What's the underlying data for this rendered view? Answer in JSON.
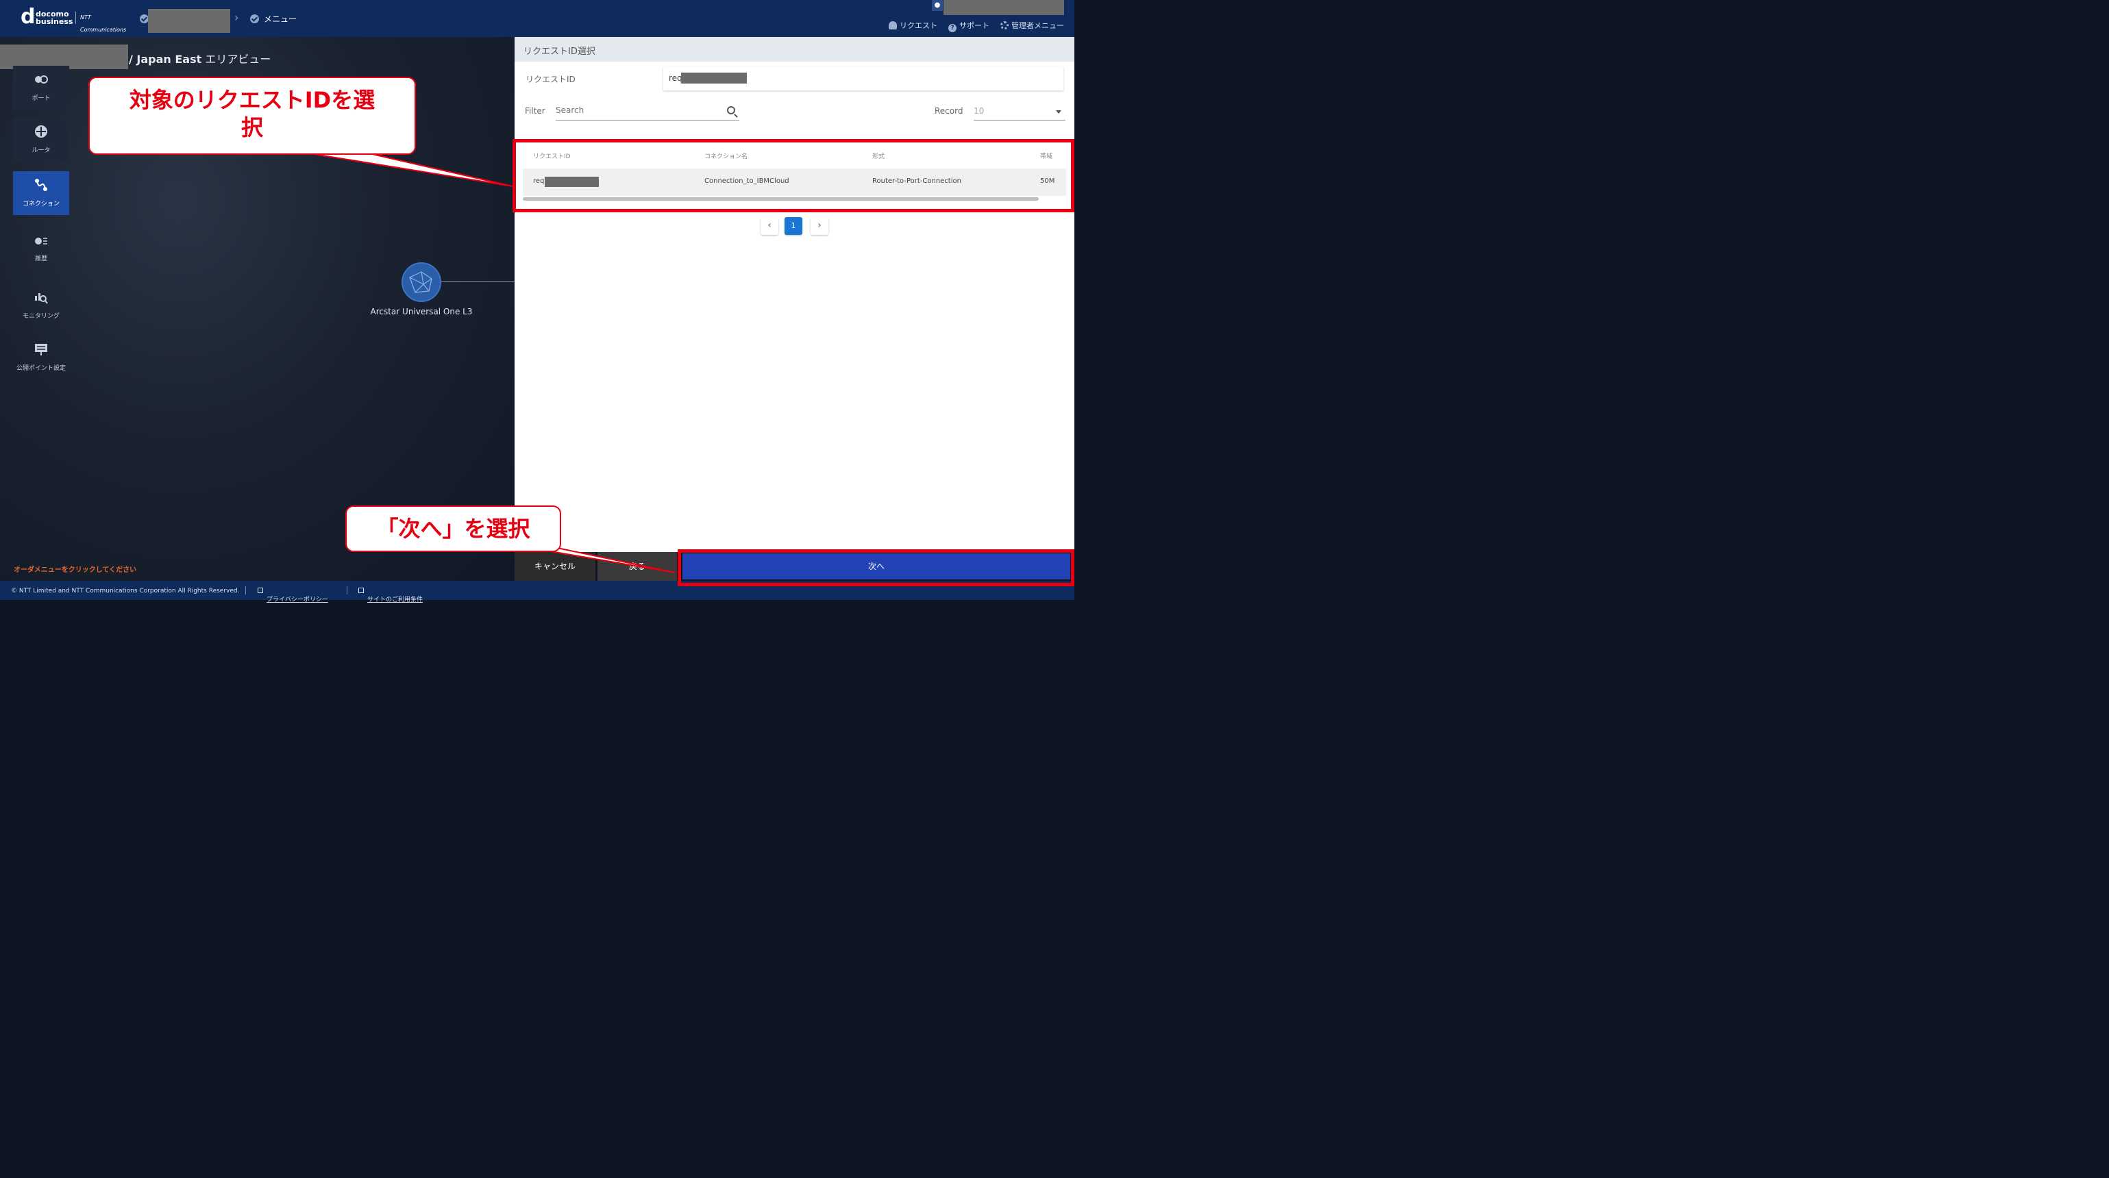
{
  "header": {
    "brand_d": "d",
    "brand_line1": "docomo",
    "brand_line2": "business",
    "ntt_logo": "NTT Communications",
    "breadcrumb_menu": "メニュー",
    "links": {
      "request": "リクエスト",
      "support": "サポート",
      "admin": "管理者メニュー"
    }
  },
  "left": {
    "page_title_region": "/ Japan East",
    "page_title_view": "エリアビュー",
    "nav": [
      {
        "label": "ポート",
        "icon": "port-icon"
      },
      {
        "label": "ルータ",
        "icon": "router-icon"
      },
      {
        "label": "コネクション",
        "icon": "connection-icon",
        "active": true
      },
      {
        "label": "履歴",
        "icon": "history-icon"
      },
      {
        "label": "モニタリング",
        "icon": "monitoring-icon"
      },
      {
        "label": "公開ポイント設定",
        "icon": "public-point-icon"
      }
    ],
    "node_label": "Arcstar Universal One L3",
    "order_message": "オーダメニューをクリックしてください"
  },
  "panel": {
    "title": "リクエストID選択",
    "request_id_label": "リクエストID",
    "request_id_value": "req",
    "filter_label": "Filter",
    "search_placeholder": "Search",
    "record_label": "Record",
    "record_value": "10",
    "table": {
      "headers": [
        "リクエストID",
        "コネクション名",
        "形式",
        "帯域"
      ],
      "rows": [
        {
          "request_id": "req",
          "connection_name": "Connection_to_IBMCloud",
          "type": "Router-to-Port-Connection",
          "bandwidth": "50M"
        }
      ]
    },
    "pagination": {
      "prev": "‹",
      "current": "1",
      "next": "›"
    }
  },
  "buttons": {
    "cancel": "キャンセル",
    "back": "戻る",
    "next": "次へ"
  },
  "footer": {
    "copyright": "© NTT Limited and NTT Communications Corporation All Rights Reserved.",
    "privacy": "プライバシーポリシー",
    "terms": "サイトのご利用条件"
  },
  "annotations": {
    "select_request_line1": "対象のリクエストIDを選",
    "select_request_line2": "択",
    "select_next": "「次へ」を選択"
  },
  "colors": {
    "annotation_red": "#e60012",
    "header_navy": "#0f2a5c",
    "primary_blue": "#2342b5",
    "active_nav": "#1e4ea8"
  }
}
